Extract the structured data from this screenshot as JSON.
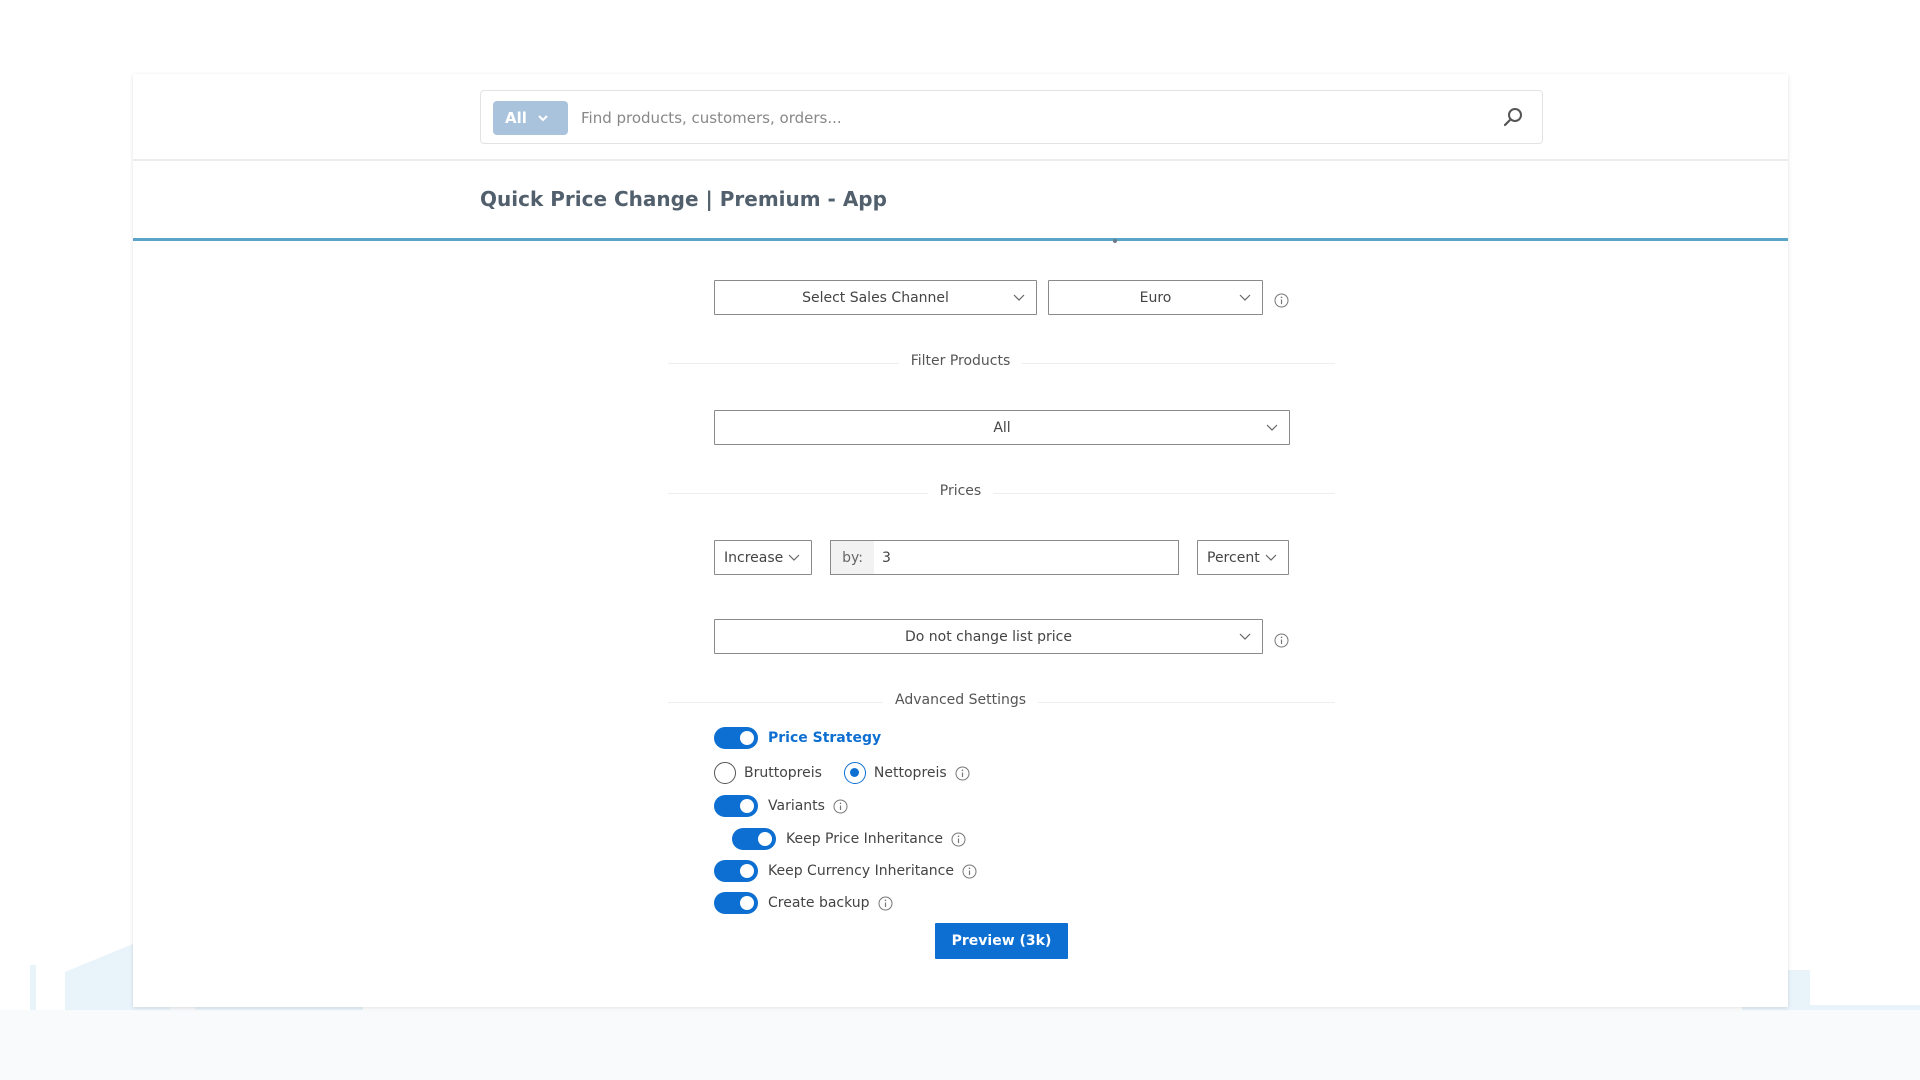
{
  "search": {
    "scope_label": "All",
    "placeholder": "Find products, customers, orders..."
  },
  "page": {
    "title": "Quick Price Change | Premium - App"
  },
  "sales": {
    "channel_select": "Select Sales Channel",
    "currency_select": "Euro"
  },
  "filter": {
    "section_label": "Filter Products",
    "products_select": "All"
  },
  "prices": {
    "section_label": "Prices",
    "direction_select": "Increase",
    "by_prefix": "by:",
    "by_value": "3",
    "unit_select": "Percent",
    "list_price_select": "Do not change list price"
  },
  "advanced": {
    "section_label": "Advanced Settings",
    "price_strategy": {
      "label": "Price Strategy",
      "enabled": true
    },
    "radios": [
      {
        "label": "Bruttopreis",
        "checked": false
      },
      {
        "label": "Nettopreis",
        "checked": true
      }
    ],
    "variants": {
      "label": "Variants",
      "enabled": true
    },
    "keep_price_inheritance": {
      "label": "Keep Price Inheritance",
      "enabled": true
    },
    "keep_currency_inheritance": {
      "label": "Keep Currency Inheritance",
      "enabled": true
    },
    "create_backup": {
      "label": "Create backup",
      "enabled": true
    }
  },
  "actions": {
    "preview_label": "Preview (3k)"
  },
  "colors": {
    "accent": "#0d6fd1",
    "header_line": "#5aa4c7",
    "scope_button": "#a9c3dd",
    "skyline": "#e8f3fa"
  }
}
